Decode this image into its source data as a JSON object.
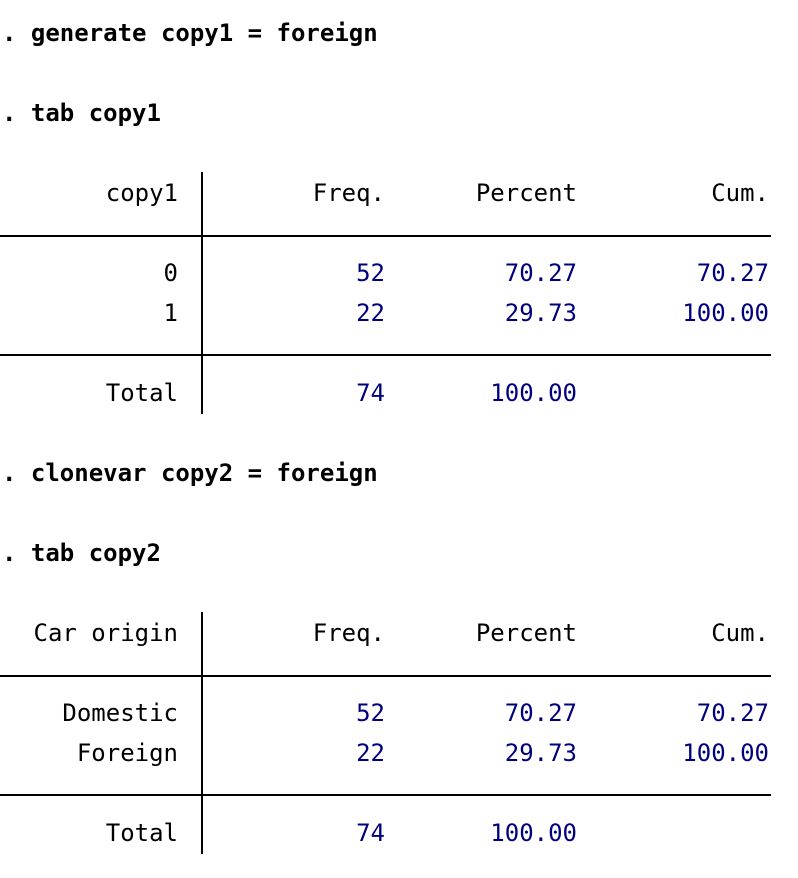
{
  "commands": [
    ". generate copy1 = foreign",
    ". tab copy1",
    ". clonevar copy2 = foreign",
    ". tab copy2"
  ],
  "table1": {
    "headers": {
      "label": "copy1",
      "freq": "Freq.",
      "percent": "Percent",
      "cum": "Cum."
    },
    "rows": [
      {
        "label": "0",
        "freq": "52",
        "percent": "70.27",
        "cum": "70.27"
      },
      {
        "label": "1",
        "freq": "22",
        "percent": "29.73",
        "cum": "100.00"
      }
    ],
    "total": {
      "label": "Total",
      "freq": "74",
      "percent": "100.00"
    }
  },
  "table2": {
    "headers": {
      "label": "Car origin",
      "freq": "Freq.",
      "percent": "Percent",
      "cum": "Cum."
    },
    "rows": [
      {
        "label": "Domestic",
        "freq": "52",
        "percent": "70.27",
        "cum": "70.27"
      },
      {
        "label": "Foreign",
        "freq": "22",
        "percent": "29.73",
        "cum": "100.00"
      }
    ],
    "total": {
      "label": "Total",
      "freq": "74",
      "percent": "100.00"
    }
  },
  "colors": {
    "text": "#000000",
    "numbers": "#00007f",
    "background": "#ffffff"
  }
}
